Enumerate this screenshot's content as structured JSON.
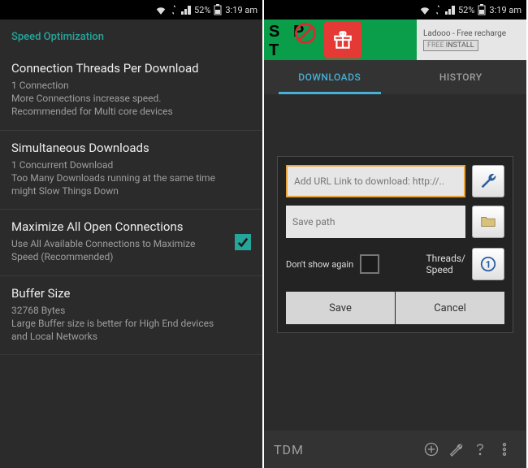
{
  "status": {
    "battery_pct": "52%",
    "time": "3:19 am"
  },
  "left": {
    "section_header": "Speed Optimization",
    "settings": {
      "threads": {
        "title": "Connection Threads Per Download",
        "value": "1 Connection",
        "desc1": "More Connections increase speed.",
        "desc2": "Recommended for Multi core devices"
      },
      "simul": {
        "title": "Simultaneous Downloads",
        "value": "1 Concurrent Download",
        "desc1": "Too Many Downloads running at the same time",
        "desc2": "might Slow Things Down"
      },
      "maxconn": {
        "title": "Maximize All Open Connections",
        "desc": "Use All Available Connections to Maximize Speed (Recommended)",
        "checked": true
      },
      "buffer": {
        "title": "Buffer Size",
        "value": "32768 Bytes",
        "desc": "Large Buffer size is better for High End devices and Local Networks"
      }
    }
  },
  "right": {
    "ad": {
      "text": "Ladooo - Free recharge",
      "btn_free": "FREE",
      "btn_install": "INSTALL",
      "stop": "S   P\nT"
    },
    "tabs": {
      "downloads": "DOWNLOADS",
      "history": "HISTORY"
    },
    "dialog": {
      "url_placeholder": "Add URL Link to download: http://..",
      "path_placeholder": "Save path",
      "dont_show": "Don't show again",
      "threads_label": "Threads/\nSpeed",
      "save": "Save",
      "cancel": "Cancel"
    },
    "bottom": {
      "brand": "TDM"
    }
  }
}
